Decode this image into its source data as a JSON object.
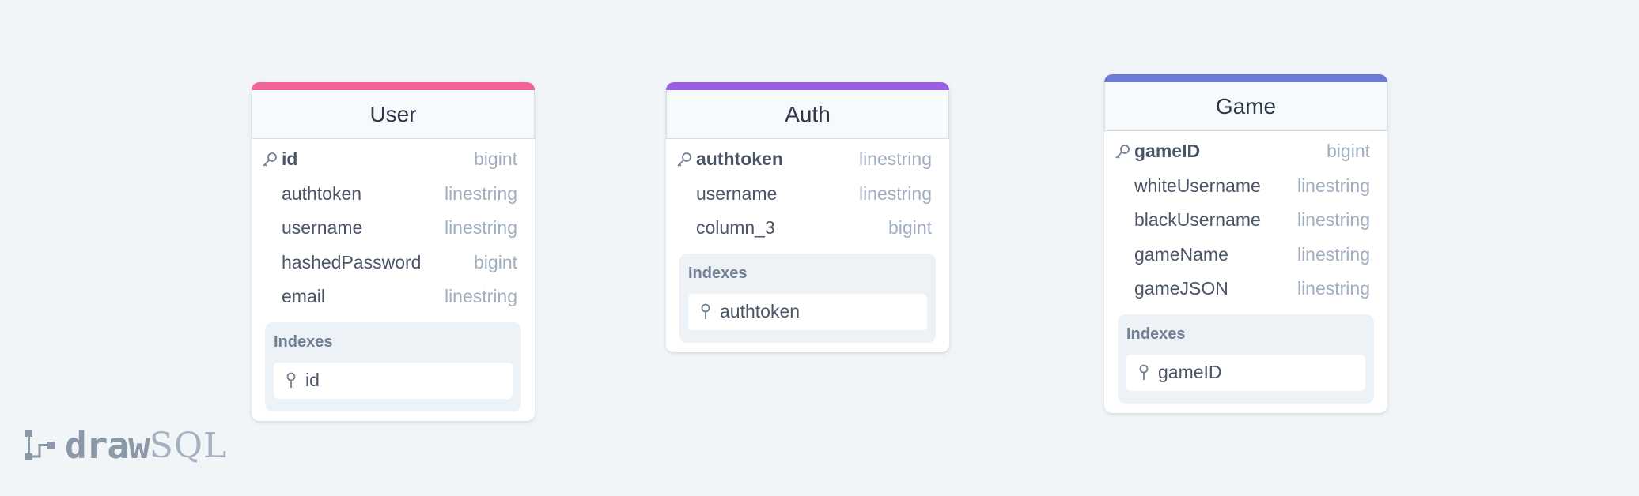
{
  "tables": [
    {
      "name": "User",
      "accent_color": "#f06595",
      "columns": [
        {
          "name": "id",
          "type": "bigint",
          "primary_key": true
        },
        {
          "name": "authtoken",
          "type": "linestring",
          "primary_key": false
        },
        {
          "name": "username",
          "type": "linestring",
          "primary_key": false
        },
        {
          "name": "hashedPassword",
          "type": "bigint",
          "primary_key": false
        },
        {
          "name": "email",
          "type": "linestring",
          "primary_key": false
        }
      ],
      "indexes_label": "Indexes",
      "indexes": [
        "id"
      ]
    },
    {
      "name": "Auth",
      "accent_color": "#9b5de5",
      "columns": [
        {
          "name": "authtoken",
          "type": "linestring",
          "primary_key": true
        },
        {
          "name": "username",
          "type": "linestring",
          "primary_key": false
        },
        {
          "name": "column_3",
          "type": "bigint",
          "primary_key": false
        }
      ],
      "indexes_label": "Indexes",
      "indexes": [
        "authtoken"
      ]
    },
    {
      "name": "Game",
      "accent_color": "#6c7bd4",
      "columns": [
        {
          "name": "gameID",
          "type": "bigint",
          "primary_key": true
        },
        {
          "name": "whiteUsername",
          "type": "linestring",
          "primary_key": false
        },
        {
          "name": "blackUsername",
          "type": "linestring",
          "primary_key": false
        },
        {
          "name": "gameName",
          "type": "linestring",
          "primary_key": false
        },
        {
          "name": "gameJSON",
          "type": "linestring",
          "primary_key": false
        }
      ],
      "indexes_label": "Indexes",
      "indexes": [
        "gameID"
      ]
    }
  ],
  "logo": {
    "text_bold": "draw",
    "text_light": "SQL",
    "icon": "drawsql-logo-icon"
  },
  "icons": {
    "primary_key": "key-icon",
    "index": "index-pin-icon"
  },
  "colors": {
    "background": "#f1f5f8",
    "type_text": "#a0aec0",
    "logo": "#8a98a8"
  }
}
